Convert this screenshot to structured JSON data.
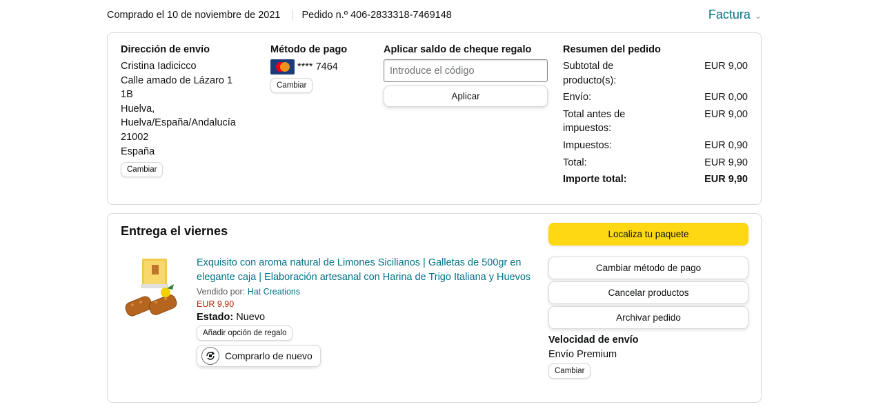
{
  "order": {
    "purchased": "Comprado el 10 de noviembre de 2021",
    "order_number": "Pedido n.º 406-2833318-7469148",
    "invoice_label": "Factura"
  },
  "shipping": {
    "title": "Dirección de envío",
    "lines": [
      "Cristina Iadicicco",
      "Calle amado de Lázaro 1",
      "1B",
      "Huelva,",
      "Huelva/España/Andalucía",
      "21002",
      "España"
    ],
    "change_label": "Cambiar"
  },
  "payment": {
    "title": "Método de pago",
    "card_text": "**** 7464",
    "change_label": "Cambiar"
  },
  "gift": {
    "title": "Aplicar saldo de cheque regalo",
    "placeholder": "Introduce el código",
    "apply_label": "Aplicar"
  },
  "summary": {
    "title": "Resumen del pedido",
    "rows": [
      {
        "label": "Subtotal de producto(s):",
        "value": "EUR 9,00"
      },
      {
        "label": "Envío:",
        "value": "EUR 0,00"
      },
      {
        "label": "Total antes de impuestos:",
        "value": "EUR 9,00"
      },
      {
        "label": "Impuestos:",
        "value": "EUR 0,90"
      },
      {
        "label": "Total:",
        "value": "EUR 9,90"
      }
    ],
    "grand_label": "Importe total:",
    "grand_value": "EUR 9,90"
  },
  "delivery": {
    "title": "Entrega el viernes",
    "product_title": "Exquisito con aroma natural de Limones Sicilianos | Galletas de 500gr en elegante caja | Elaboración artesanal con Harina de Trigo Italiana y Huevos",
    "sold_by_label": "Vendido por:",
    "seller": "Hat Creations",
    "price": "EUR 9,90",
    "status_label": "Estado:",
    "status_value": "Nuevo",
    "gift_option_label": "Añadir opción de regalo",
    "buy_again_label": "Comprarlo de nuevo"
  },
  "actions": {
    "track": "Localiza tu paquete",
    "change_payment": "Cambiar método de pago",
    "cancel": "Cancelar productos",
    "archive": "Archivar pedido",
    "speed_title": "Velocidad de envío",
    "speed_value": "Envío Premium",
    "speed_change": "Cambiar"
  },
  "colors": {
    "link": "#007185",
    "price": "#b12704",
    "primary_button": "#ffd814",
    "border": "#d5d9d9"
  }
}
